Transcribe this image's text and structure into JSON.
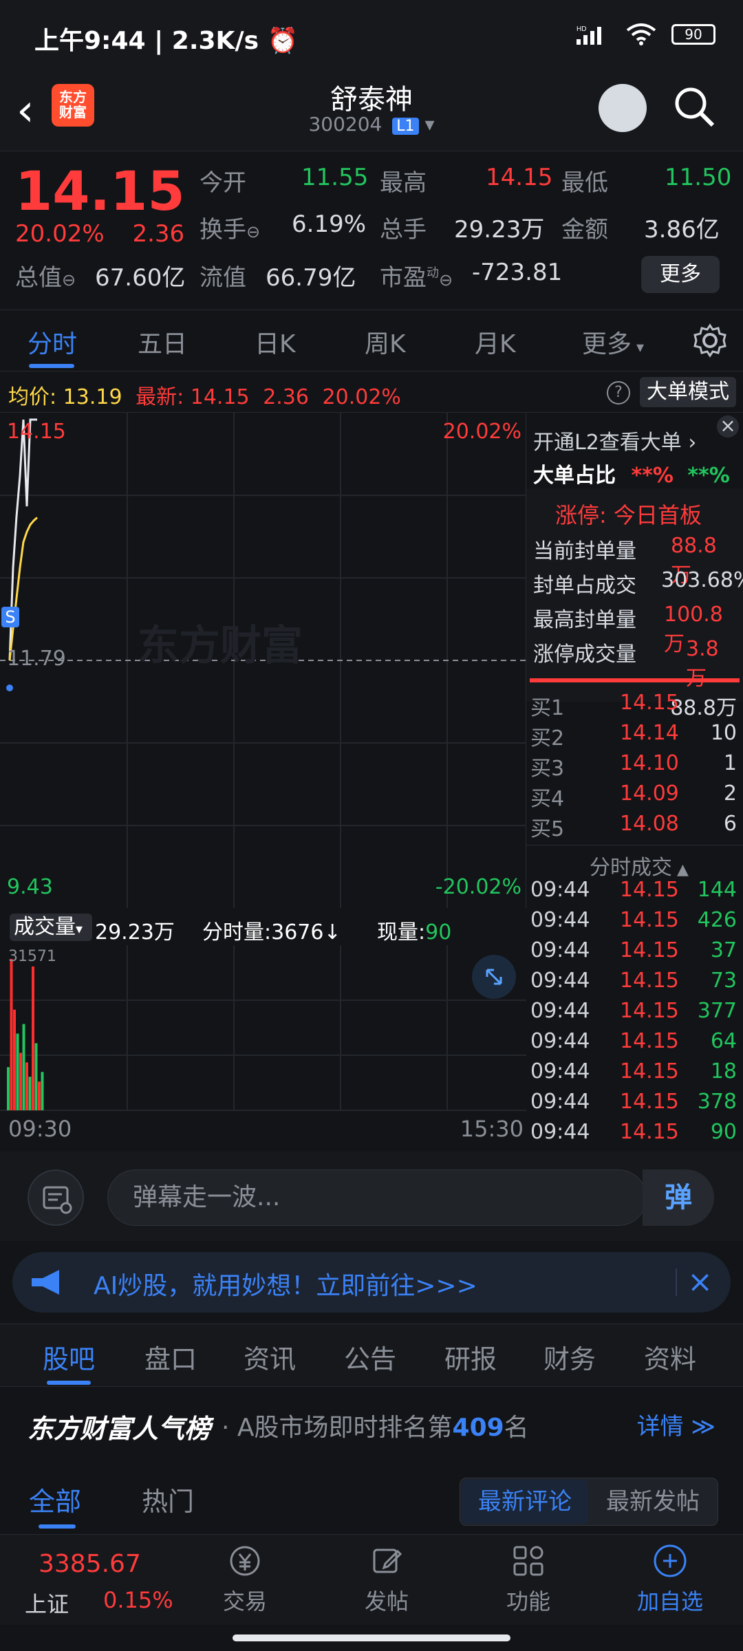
{
  "status": {
    "time": "上午9:44",
    "speed": "2.3K/s",
    "battery": "90"
  },
  "header": {
    "title": "舒泰神",
    "code": "300204",
    "level": "L1",
    "logo_text": "东方财富"
  },
  "quote": {
    "price": "14.15",
    "pct": "20.02%",
    "chg": "2.36",
    "jin_kai_k": "今开",
    "jin_kai_v": "11.55",
    "zuigao_k": "最高",
    "zuigao_v": "14.15",
    "zuidi_k": "最低",
    "zuidi_v": "11.50",
    "huanshou_k": "换手",
    "huanshou_v": "6.19%",
    "zongshou_k": "总手",
    "zongshou_v": "29.23万",
    "jine_k": "金额",
    "jine_v": "3.86亿",
    "zongzhi_k": "总值",
    "zongzhi_v": "67.60亿",
    "liuzhi_k": "流值",
    "liuzhi_v": "66.79亿",
    "shiying_k": "市盈",
    "shiying_sup": "动",
    "shiying_v": "-723.81",
    "more_btn": "更多"
  },
  "tabs": {
    "items": [
      "分时",
      "五日",
      "日K",
      "周K",
      "月K",
      "更多"
    ]
  },
  "avgbar": {
    "avg_label": "均价:",
    "avg_value": "13.19",
    "latest_label": "最新:",
    "latest_price": "14.15",
    "latest_chg": "2.36",
    "latest_pct": "20.02%",
    "help": "?",
    "mode": "大单模式"
  },
  "chart": {
    "labels": {
      "top_left": "14.15",
      "top_right": "20.02%",
      "mid": "11.79",
      "bottom_left": "9.43",
      "bottom_right": "-20.02%",
      "s_marker": "S",
      "watermark": "东方财富"
    }
  },
  "chart_data": {
    "type": "line",
    "y_price_range": [
      9.43,
      14.15
    ],
    "series": [
      {
        "x": [
          0,
          1,
          2,
          3,
          4,
          5,
          6,
          7,
          8
        ],
        "values": [
          11.79,
          12.7,
          13.2,
          13.6,
          14.15,
          13.3,
          14.15,
          14.15,
          14.15
        ]
      },
      {
        "x": [
          0,
          1,
          2,
          3,
          4,
          5,
          6,
          7,
          8
        ],
        "values": [
          11.79,
          12.1,
          12.4,
          12.7,
          12.95,
          13.05,
          13.12,
          13.16,
          13.19
        ]
      }
    ],
    "volume_bars": [
      {
        "value": 9000,
        "color": "green"
      },
      {
        "value": 31571,
        "color": "red"
      },
      {
        "value": 21000,
        "color": "red"
      },
      {
        "value": 16000,
        "color": "green"
      },
      {
        "value": 12000,
        "color": "red"
      },
      {
        "value": 18000,
        "color": "green"
      },
      {
        "value": 10000,
        "color": "red"
      },
      {
        "value": 7000,
        "color": "green"
      },
      {
        "value": 30000,
        "color": "red"
      },
      {
        "value": 14000,
        "color": "green"
      },
      {
        "value": 6000,
        "color": "red"
      },
      {
        "value": 8000,
        "color": "green"
      }
    ],
    "volume_max_label": "31571"
  },
  "volume": {
    "label": "成交量",
    "total": "29.23万",
    "fenshi": "分时量:3676↓",
    "xianliang_label": "现量:",
    "xianliang_value": "90",
    "time_start": "09:30",
    "time_end": "15:30"
  },
  "right": {
    "l2": "开通L2查看大单",
    "dadan_label": "大单占比",
    "dadan_red": "**%",
    "dadan_green": "**%",
    "zhangting": "涨停: 今日首板",
    "rows": [
      {
        "k": "当前封单量",
        "v": "88.8万"
      },
      {
        "k": "封单占成交",
        "v": "303.68%"
      },
      {
        "k": "最高封单量",
        "v": "100.8万"
      },
      {
        "k": "涨停成交量",
        "v": "3.8万"
      }
    ],
    "bids": [
      {
        "k": "买1",
        "p": "14.15",
        "v": "88.8万"
      },
      {
        "k": "买2",
        "p": "14.14",
        "v": "10"
      },
      {
        "k": "买3",
        "p": "14.10",
        "v": "1"
      },
      {
        "k": "买4",
        "p": "14.09",
        "v": "2"
      },
      {
        "k": "买5",
        "p": "14.08",
        "v": "6"
      }
    ],
    "fenshi_title": "分时成交",
    "trades": [
      {
        "t": "09:44",
        "p": "14.15",
        "v": "144"
      },
      {
        "t": "09:44",
        "p": "14.15",
        "v": "426"
      },
      {
        "t": "09:44",
        "p": "14.15",
        "v": "37"
      },
      {
        "t": "09:44",
        "p": "14.15",
        "v": "73"
      },
      {
        "t": "09:44",
        "p": "14.15",
        "v": "377"
      },
      {
        "t": "09:44",
        "p": "14.15",
        "v": "64"
      },
      {
        "t": "09:44",
        "p": "14.15",
        "v": "18"
      },
      {
        "t": "09:44",
        "p": "14.15",
        "v": "378"
      },
      {
        "t": "09:44",
        "p": "14.15",
        "v": "90"
      }
    ]
  },
  "danmaku": {
    "placeholder": "弹幕走一波...",
    "button": "弹"
  },
  "ai": {
    "text": "AI炒股，就用妙想！立即前往>>>"
  },
  "sections": {
    "items": [
      "股吧",
      "盘口",
      "资讯",
      "公告",
      "研报",
      "财务",
      "资料"
    ]
  },
  "rank": {
    "left": "东方财富人气榜",
    "mid_prefix": "· A股市场即时排名第",
    "mid_num": "409",
    "mid_suffix": "名",
    "right": "详情 ≫"
  },
  "filters": {
    "all": "全部",
    "hot": "热门",
    "seg_a": "最新评论",
    "seg_b": "最新发帖"
  },
  "bottom": {
    "index_value": "3385.67",
    "index_name": "上证",
    "index_pct": "0.15%",
    "nav": [
      "交易",
      "发帖",
      "功能",
      "加自选"
    ]
  }
}
